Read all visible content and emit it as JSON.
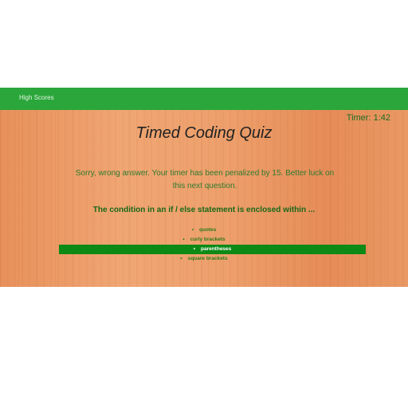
{
  "nav": {
    "high_scores_label": "High Scores"
  },
  "quiz": {
    "timer_text": "Timer: 1:42",
    "title": "Timed Coding Quiz",
    "feedback": "Sorry, wrong answer. Your timer has been penalized by 15. Better luck on this next question.",
    "question": "The condition in an if / else statement is enclosed within ...",
    "choices": [
      {
        "label": "quotes"
      },
      {
        "label": "curly brackets"
      },
      {
        "label": "parentheses"
      },
      {
        "label": "square brackets"
      }
    ],
    "bullet": "•"
  },
  "colors": {
    "navbar": "#2aa63a",
    "selected_choice": "#0d8a16"
  }
}
